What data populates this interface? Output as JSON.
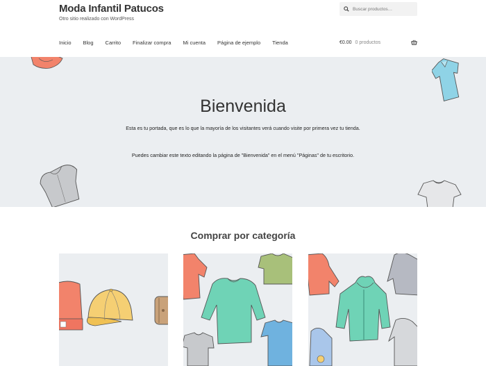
{
  "site": {
    "title": "Moda Infantil Patucos",
    "description": "Otro sitio realizado con WordPress"
  },
  "search": {
    "placeholder": "Buscar productos…"
  },
  "nav": {
    "items": [
      "Inicio",
      "Blog",
      "Carrito",
      "Finalizar compra",
      "Mi cuenta",
      "Página de ejemplo",
      "Tienda"
    ]
  },
  "cart": {
    "amount": "€0.00",
    "count": "0 productos"
  },
  "hero": {
    "title": "Bienvenida",
    "paragraph1": "Esta es tu portada, que es lo que la mayoría de los visitantes verá cuando visite por primera vez tu tienda.",
    "paragraph2": "Puedes cambiar este texto editando la página de \"Bienvenida\" en el menú \"Páginas\" de tu escritorio."
  },
  "categories": {
    "title": "Comprar por categoría"
  },
  "colors": {
    "hero_bg": "#ebeef1",
    "text": "#333333",
    "coral": "#f2836b",
    "mint": "#6fd3b6",
    "sky": "#8fd3e6",
    "mustard": "#f5cf73",
    "grey": "#c7c9cc"
  }
}
